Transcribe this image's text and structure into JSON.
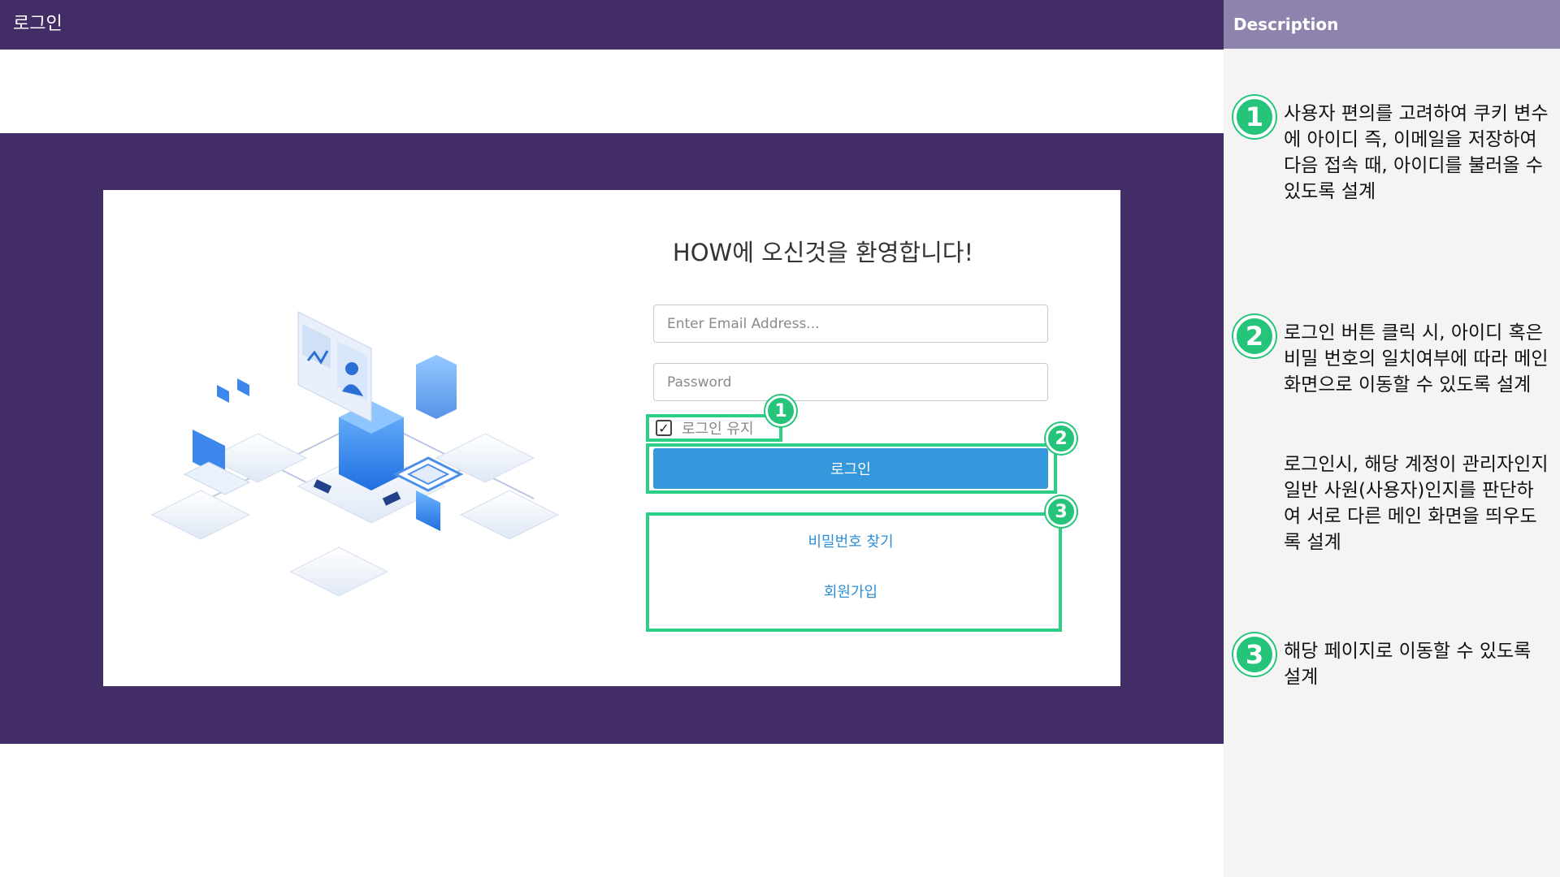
{
  "topbar": {
    "title": "로그인"
  },
  "login": {
    "welcome": "HOW에 오신것을 환영합니다!",
    "email_placeholder": "Enter Email Address...",
    "password_placeholder": "Password",
    "remember_label": "로그인 유지",
    "remember_checked": true,
    "login_button": "로그인",
    "find_password": "비밀번호 찾기",
    "signup": "회원가입"
  },
  "annotations": {
    "one": "1",
    "two": "2",
    "three": "3"
  },
  "description": {
    "header": "Description",
    "items": [
      {
        "num": "1",
        "text": "사용자 편의를 고려하여 쿠키 변수에 아이디 즉, 이메일을 저장하여 다음 접속 때, 아이디를 불러올 수 있도록 설계"
      },
      {
        "num": "2",
        "text": "로그인 버튼 클릭 시, 아이디 혹은 비밀 번호의 일치여부에 따라 메인화면으로 이동할 수 있도록 설계",
        "text2": "로그인시, 해당 계정이 관리자인지 일반 사원(사용자)인지를 판단하여 서로 다른 메인 화면을 띄우도록 설계"
      },
      {
        "num": "3",
        "text": "해당 페이지로 이동할 수 있도록 설계"
      }
    ]
  },
  "colors": {
    "header_purple": "#432d66",
    "desc_header": "#8e83ad",
    "button_blue": "#3597dc",
    "link_blue": "#2f8fd6",
    "annotation_green": "#2ccf85"
  }
}
